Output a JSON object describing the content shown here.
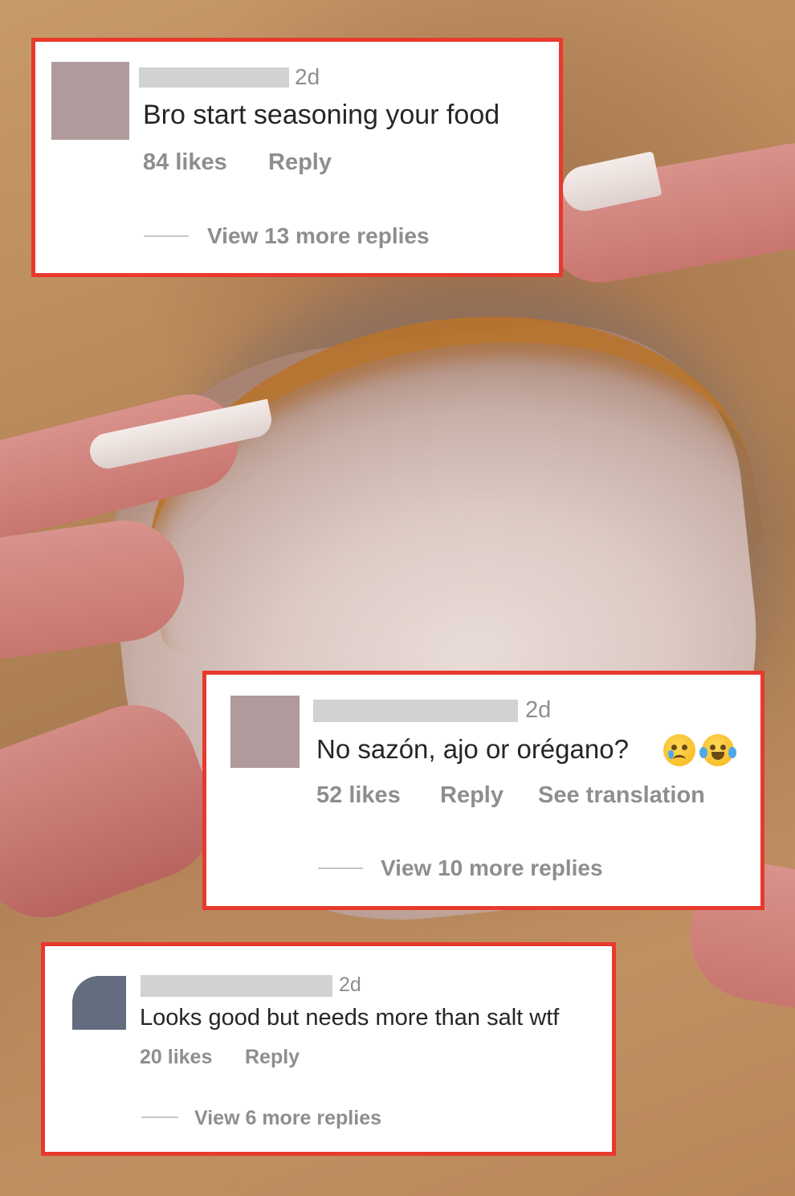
{
  "comments": [
    {
      "time": "2d",
      "text": "Bro start seasoning your food",
      "likes": "84 likes",
      "reply": "Reply",
      "view_replies": "View 13 more replies",
      "avatar_color": "#b09a9b"
    },
    {
      "time": "2d",
      "text": "No sazón, ajo or orégano?",
      "emojis": [
        "crying-face",
        "tears-of-joy-face"
      ],
      "likes": "52 likes",
      "reply": "Reply",
      "translate": "See translation",
      "view_replies": "View 10 more replies",
      "avatar_color": "#b09a9b"
    },
    {
      "time": "2d",
      "text": "Looks good but needs more than salt wtf",
      "likes": "20 likes",
      "reply": "Reply",
      "view_replies": "View 6 more replies",
      "avatar_color": "#646c7f"
    }
  ],
  "colors": {
    "highlight_border": "#e8392d",
    "meta_text": "#8e8e8e",
    "body_text": "#262626",
    "redaction": "#d2d2d2"
  }
}
